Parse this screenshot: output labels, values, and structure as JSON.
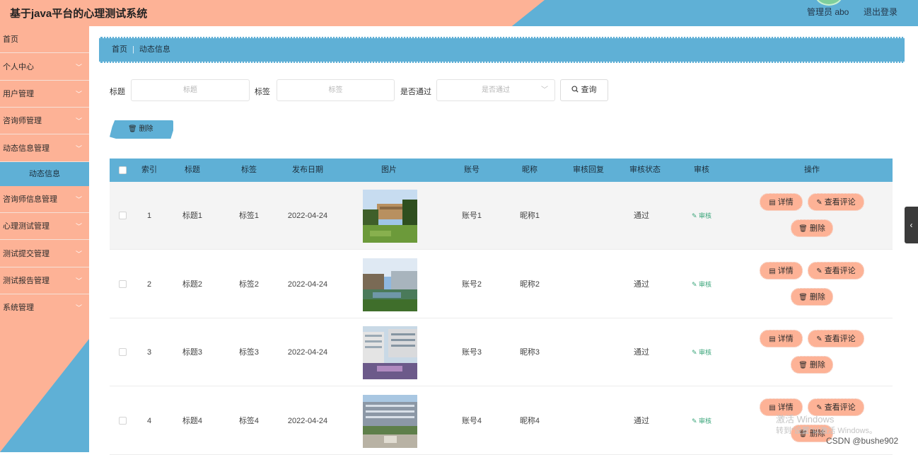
{
  "header": {
    "title": "基于java平台的心理测试系统",
    "admin": "管理员 abo",
    "logout": "退出登录"
  },
  "sidebar": {
    "items": [
      {
        "label": "首页",
        "chevron": false
      },
      {
        "label": "个人中心",
        "chevron": true
      },
      {
        "label": "用户管理",
        "chevron": true
      },
      {
        "label": "咨询师管理",
        "chevron": true
      },
      {
        "label": "动态信息管理",
        "chevron": true
      },
      {
        "label": "咨询师信息管理",
        "chevron": true
      },
      {
        "label": "心理测试管理",
        "chevron": true
      },
      {
        "label": "测试提交管理",
        "chevron": true
      },
      {
        "label": "测试报告管理",
        "chevron": true
      },
      {
        "label": "系统管理",
        "chevron": true
      }
    ],
    "active_sub": "动态信息"
  },
  "breadcrumb": {
    "home": "首页",
    "separator": "|",
    "current": "动态信息"
  },
  "search": {
    "title_label": "标题",
    "title_placeholder": "标题",
    "tag_label": "标签",
    "tag_placeholder": "标签",
    "pass_label": "是否通过",
    "pass_placeholder": "是否通过",
    "query_label": "查询",
    "query_icon": "search-icon"
  },
  "toolbar": {
    "delete_label": "删除",
    "delete_icon": "trash-icon"
  },
  "table": {
    "headers": [
      "索引",
      "标题",
      "标签",
      "发布日期",
      "图片",
      "账号",
      "昵称",
      "审核回复",
      "审核状态",
      "审核",
      "操作"
    ],
    "rows": [
      {
        "index": "1",
        "title": "标题1",
        "tag": "标签1",
        "date": "2022-04-24",
        "image": "campus-photo-1",
        "account": "账号1",
        "nickname": "昵称1",
        "reply": "",
        "status": "通过",
        "audit": "审核"
      },
      {
        "index": "2",
        "title": "标题2",
        "tag": "标签2",
        "date": "2022-04-24",
        "image": "campus-photo-2",
        "account": "账号2",
        "nickname": "昵称2",
        "reply": "",
        "status": "通过",
        "audit": "审核"
      },
      {
        "index": "3",
        "title": "标题3",
        "tag": "标签3",
        "date": "2022-04-24",
        "image": "campus-photo-3",
        "account": "账号3",
        "nickname": "昵称3",
        "reply": "",
        "status": "通过",
        "audit": "审核"
      },
      {
        "index": "4",
        "title": "标题4",
        "tag": "标签4",
        "date": "2022-04-24",
        "image": "campus-photo-4",
        "account": "账号4",
        "nickname": "昵称4",
        "reply": "",
        "status": "通过",
        "audit": "审核"
      }
    ],
    "actions": {
      "detail": "详情",
      "comments": "查看评论",
      "delete": "删除"
    }
  },
  "overlay": {
    "activate_line1": "激活 Windows",
    "activate_line2": "转到“设置”以激活 Windows。",
    "credit": "CSDN @bushe902"
  },
  "colors": {
    "salmon": "#fdb296",
    "blue": "#5fb0d6"
  }
}
